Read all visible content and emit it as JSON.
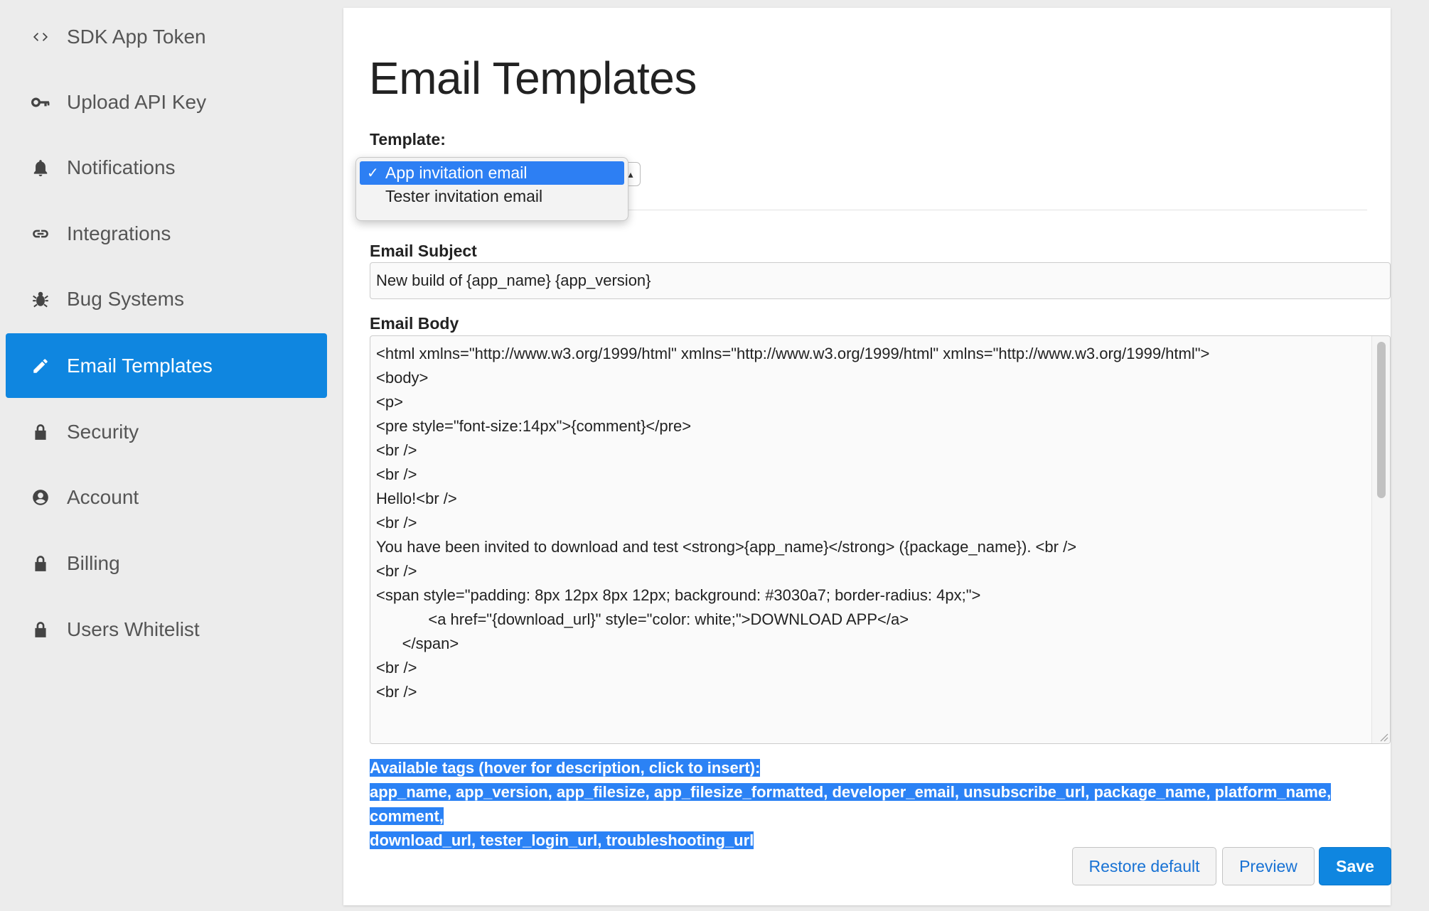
{
  "sidebar": {
    "items": [
      {
        "label": "SDK App Token",
        "icon": "code-icon"
      },
      {
        "label": "Upload API Key",
        "icon": "key-icon"
      },
      {
        "label": "Notifications",
        "icon": "bell-icon"
      },
      {
        "label": "Integrations",
        "icon": "link-icon"
      },
      {
        "label": "Bug Systems",
        "icon": "bug-icon"
      },
      {
        "label": "Email Templates",
        "icon": "pencil-icon",
        "active": true
      },
      {
        "label": "Security",
        "icon": "lock-icon"
      },
      {
        "label": "Account",
        "icon": "user-circle-icon"
      },
      {
        "label": "Billing",
        "icon": "lock-icon"
      },
      {
        "label": "Users Whitelist",
        "icon": "lock-icon"
      }
    ]
  },
  "main": {
    "title": "Email Templates",
    "template_label": "Template:",
    "template_options": [
      {
        "label": "App invitation email",
        "selected": true
      },
      {
        "label": "Tester invitation email",
        "selected": false
      }
    ],
    "subject_label": "Email Subject",
    "subject_value": "New build of {app_name} {app_version}",
    "body_label": "Email Body",
    "body_lines": [
      "<html xmlns=\"http://www.w3.org/1999/html\" xmlns=\"http://www.w3.org/1999/html\" xmlns=\"http://www.w3.org/1999/html\">",
      "<body>",
      "<p>",
      "<pre style=\"font-size:14px\">{comment}</pre>",
      "<br />",
      "<br />",
      "Hello!<br />",
      "<br />",
      "You have been invited to download and test <strong>{app_name}</strong> ({package_name}). <br />",
      "<br />",
      "<span style=\"padding: 8px 12px 8px 12px; background: #3030a7; border-radius: 4px;\">",
      "            <a href=\"{download_url}\" style=\"color: white;\">DOWNLOAD APP</a>",
      "      </span>",
      "<br />",
      "<br />"
    ],
    "tags_heading": "Available tags (hover for description, click to insert):",
    "tags_line1": "app_name, app_version, app_filesize, app_filesize_formatted, developer_email, unsubscribe_url, package_name, platform_name, comment,",
    "tags_line2": "download_url, tester_login_url, troubleshooting_url",
    "buttons": {
      "restore": "Restore default",
      "preview": "Preview",
      "save": "Save"
    }
  },
  "colors": {
    "accent": "#0f86e0",
    "selection": "#2b82f5"
  }
}
